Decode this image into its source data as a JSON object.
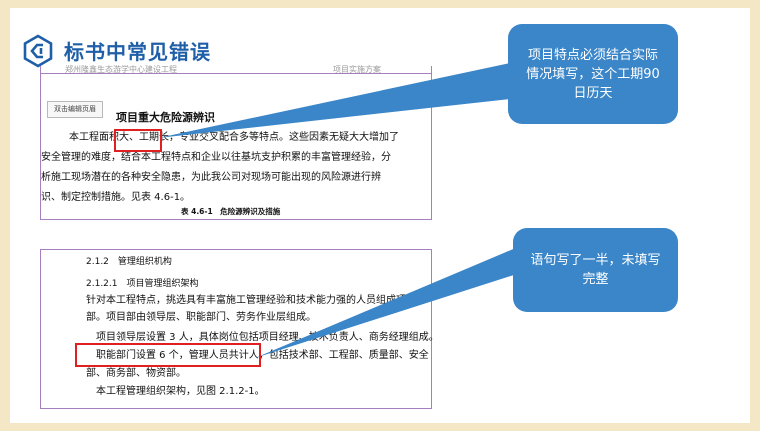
{
  "slide": {
    "title": "标书中常见错误",
    "logo_icon": "company-logo-icon"
  },
  "doc1": {
    "header_left": "郑州隆鑫生态游学中心建设工程",
    "header_right": "项目实施方案",
    "edit_button": "双击编辑页眉",
    "section_title": "项目重大危险源辨识",
    "lines": [
      "本工程面积大、工期长，专业交叉配合多等特点。这些因素无疑大大增加了",
      "安全管理的难度，结合本工程特点和企业以往基坑支护积累的丰富管理经验，分",
      "析施工现场潜在的各种安全隐患，为此我公司对现场可能出现的风险源进行辨",
      "识、制定控制措施。见表 4.6-1。"
    ],
    "caption": "表 4.6-1　危险源辨识及措施"
  },
  "doc2": {
    "h2": "2.1.2　管理组织机构",
    "h3": "2.1.2.1　项目管理组织架构",
    "lines": [
      "针对本工程特点，挑选具有丰富施工管理经验和技术能力强的人员组成项目",
      "部。项目部由领导层、职能部门、劳务作业层组成。",
      "项目领导层设置 3 人，具体岗位包括项目经理、技术负责人、商务经理组成。",
      "职能部门设置 6 个，管理人员共计人，包括技术部、工程部、质量部、安全",
      "部、商务部、物资部。",
      "本工程管理组织架构，见图 2.1.2-1。"
    ]
  },
  "callouts": [
    {
      "text": "项目特点必须结合实际情况填写，这个工期90日历天"
    },
    {
      "text": "语句写了一半，未填写完整"
    }
  ],
  "colors": {
    "accent": "#1f5fa8",
    "bubble": "#3a86c9",
    "highlight": "#e02020",
    "doc_border": "#a57fbf",
    "background": "#f3e7c6"
  }
}
